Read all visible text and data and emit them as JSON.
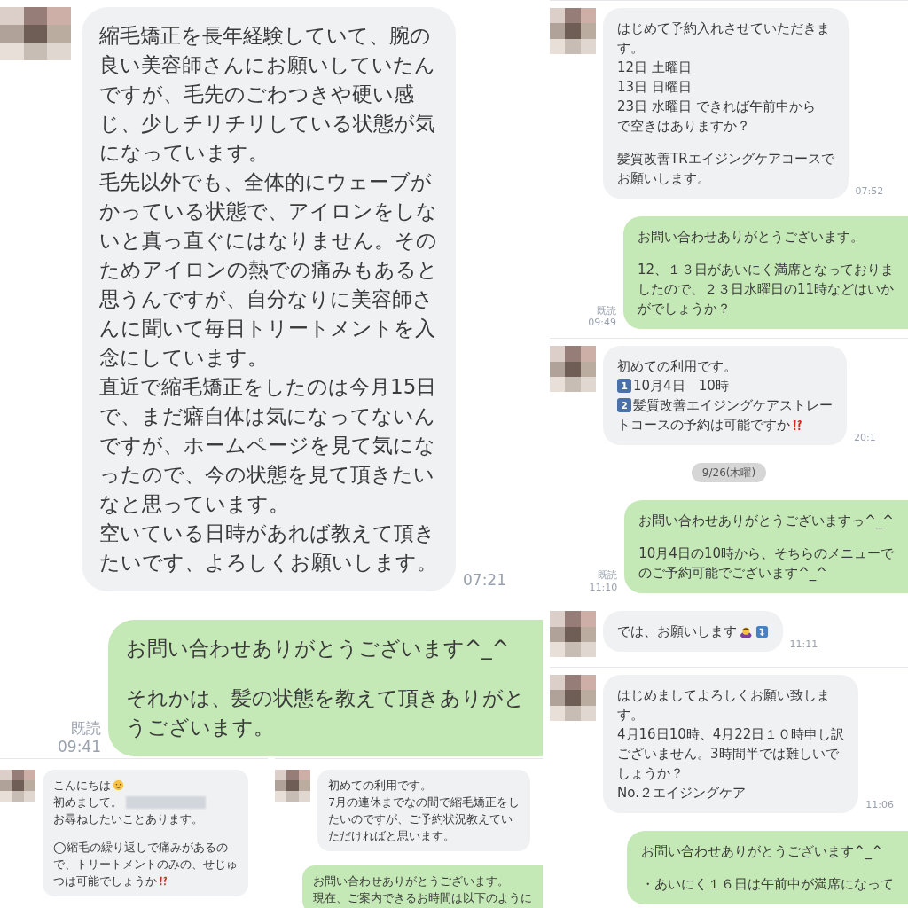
{
  "left": {
    "main": {
      "kind": "large",
      "messages": [
        {
          "kind": "incoming",
          "time": "07:21",
          "lines": [
            {
              "kind": "text",
              "text": "縮毛矯正を長年経験していて、腕の"
            },
            {
              "kind": "text",
              "text": "良い美容師さんにお願いしていたん"
            },
            {
              "kind": "text",
              "text": "ですが、毛先のごわつきや硬い感"
            },
            {
              "kind": "text",
              "text": "じ、少しチリチリしている状態が気"
            },
            {
              "kind": "text",
              "text": "になっています。"
            },
            {
              "kind": "text",
              "text": "毛先以外でも、全体的にウェーブが"
            },
            {
              "kind": "text",
              "text": "かっている状態で、アイロンをしな"
            },
            {
              "kind": "text",
              "text": "いと真っ直ぐにはなりません。その"
            },
            {
              "kind": "text",
              "text": "ためアイロンの熱での痛みもあると"
            },
            {
              "kind": "text",
              "text": "思うんですが、自分なりに美容師さ"
            },
            {
              "kind": "text",
              "text": "んに聞いて毎日トリートメントを入"
            },
            {
              "kind": "text",
              "text": "念にしています。"
            },
            {
              "kind": "text",
              "text": "直近で縮毛矯正をしたのは今月15日"
            },
            {
              "kind": "text",
              "text": "で、まだ癖自体は気になってないん"
            },
            {
              "kind": "text",
              "text": "ですが、ホームページを見て気にな"
            },
            {
              "kind": "text",
              "text": "ったので、今の状態を見て頂きたい"
            },
            {
              "kind": "text",
              "text": "なと思っています。"
            },
            {
              "kind": "text",
              "text": "空いている日時があれば教えて頂き"
            },
            {
              "kind": "text",
              "text": "たいです、よろしくお願いします。"
            }
          ]
        },
        {
          "kind": "outgoing",
          "read": "既読",
          "time": "09:41",
          "lines": [
            {
              "kind": "text",
              "text": "お問い合わせありがとうございます^_^"
            },
            {
              "kind": "blank"
            },
            {
              "kind": "text",
              "text": "それかは、髪の状態を教えて頂きありがと"
            },
            {
              "kind": "text",
              "text": "うございます。"
            }
          ]
        }
      ]
    },
    "bottom": [
      {
        "kind": "small",
        "messages": [
          {
            "kind": "incoming",
            "lines": [
              {
                "kind": "text",
                "text": "こんにちは",
                "emoji": [
                  {
                    "kind": "smile"
                  }
                ]
              },
              {
                "kind": "redacted",
                "text": "初めまして。"
              },
              {
                "kind": "text",
                "text": "お尋ねしたいことあります。"
              },
              {
                "kind": "blank"
              },
              {
                "kind": "text",
                "text": "◯縮毛の繰り返しで痛みがあるの"
              },
              {
                "kind": "text",
                "text": "で、トリートメントのみの、せじゅ"
              },
              {
                "kind": "text",
                "text": "つは可能でしょうか",
                "emoji": [
                  {
                    "kind": "exclaim"
                  }
                ]
              }
            ]
          }
        ]
      },
      {
        "kind": "small",
        "messages": [
          {
            "kind": "incoming",
            "lines": [
              {
                "kind": "text",
                "text": "初めての利用です。"
              },
              {
                "kind": "text",
                "text": "7月の連休までなの間で縮毛矯正をし"
              },
              {
                "kind": "text",
                "text": "たいのですが、ご予約状況教えてい"
              },
              {
                "kind": "text",
                "text": "ただければと思います。"
              }
            ]
          },
          {
            "kind": "outgoing",
            "lines": [
              {
                "kind": "text",
                "text": "お問い合わせありがとうございます。"
              },
              {
                "kind": "text",
                "text": "現在、ご案内できるお時間は以下のように"
              }
            ]
          }
        ]
      }
    ]
  },
  "right": [
    {
      "kind": "medium",
      "messages": [
        {
          "kind": "incoming",
          "time": "07:52",
          "lines": [
            {
              "kind": "text",
              "text": "はじめて予約入れさせていただきま"
            },
            {
              "kind": "text",
              "text": "す。"
            },
            {
              "kind": "text",
              "text": "12日 土曜日"
            },
            {
              "kind": "text",
              "text": "13日 日曜日"
            },
            {
              "kind": "text",
              "text": "23日 水曜日 できれば午前中から"
            },
            {
              "kind": "text",
              "text": "で空きはありますか？"
            },
            {
              "kind": "blank"
            },
            {
              "kind": "text",
              "text": "髪質改善TRエイジングケアコースで"
            },
            {
              "kind": "text",
              "text": "お願いします。"
            }
          ]
        },
        {
          "kind": "outgoing",
          "read": "既読",
          "time": "09:49",
          "lines": [
            {
              "kind": "text",
              "text": "お問い合わせありがとうございます。"
            },
            {
              "kind": "blank"
            },
            {
              "kind": "text",
              "text": "12、１３日があいにく満席となっておりま"
            },
            {
              "kind": "text",
              "text": "したので、２３日水曜日の11時などはいか"
            },
            {
              "kind": "text",
              "text": "がでしょうか？"
            }
          ]
        }
      ]
    },
    {
      "kind": "medium",
      "messages": [
        {
          "kind": "incoming",
          "time": "20:1",
          "lines": [
            {
              "kind": "text",
              "text": "初めての利用です。"
            },
            {
              "kind": "text",
              "keycap": "1",
              "text": "10月4日　10時"
            },
            {
              "kind": "text",
              "keycap": "2",
              "text": "髪質改善エイジングケアストレー"
            },
            {
              "kind": "text",
              "text": "トコースの予約は可能ですか",
              "emoji": [
                {
                  "kind": "exclaim"
                }
              ]
            }
          ]
        },
        {
          "kind": "date",
          "text": "9/26(木曜)"
        },
        {
          "kind": "outgoing",
          "read": "既読",
          "time": "11:10",
          "lines": [
            {
              "kind": "text",
              "text": "お問い合わせありがとうございますっ^_^"
            },
            {
              "kind": "blank"
            },
            {
              "kind": "text",
              "text": "10月4日の10時から、そちらのメニューで"
            },
            {
              "kind": "text",
              "text": "のご予約可能でございます^_^"
            }
          ]
        },
        {
          "kind": "incoming",
          "time": "11:11",
          "lines": [
            {
              "kind": "text",
              "text": "では、お願いします",
              "emoji": [
                {
                  "kind": "bow"
                },
                {
                  "kind": "arrow"
                }
              ]
            }
          ]
        }
      ]
    },
    {
      "kind": "medium",
      "messages": [
        {
          "kind": "incoming",
          "time": "11:06",
          "lines": [
            {
              "kind": "text",
              "text": "はじめましてよろしくお願い致しま"
            },
            {
              "kind": "text",
              "text": "す。"
            },
            {
              "kind": "text",
              "text": "4月16日10時、4月22日１０時申し訳"
            },
            {
              "kind": "text",
              "text": "ございません。3時間半では難しいで"
            },
            {
              "kind": "text",
              "text": "しょうか？"
            },
            {
              "kind": "text",
              "text": "No.２エイジングケア"
            }
          ]
        },
        {
          "kind": "outgoing",
          "lines": [
            {
              "kind": "text",
              "text": "お問い合わせありがとうございます^_^"
            },
            {
              "kind": "blank"
            },
            {
              "kind": "text",
              "text": "・あいにく１６日は午前中が満席になって"
            }
          ]
        }
      ]
    }
  ]
}
